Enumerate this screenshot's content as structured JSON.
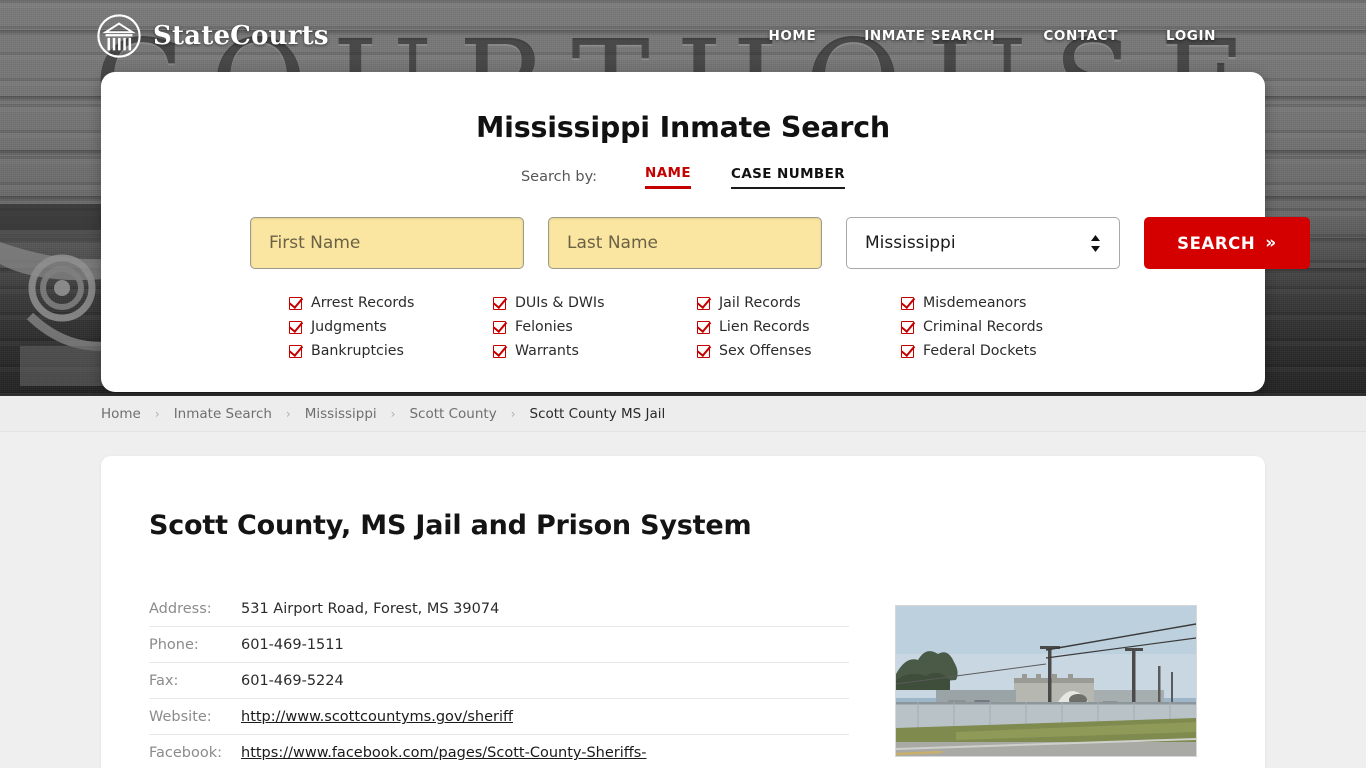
{
  "site": {
    "brand_name": "StateCourts",
    "logo_icon": "courthouse-circle-icon",
    "hero_background_word": "COURTHOUSE"
  },
  "nav": {
    "items": [
      {
        "label": "HOME",
        "name": "home"
      },
      {
        "label": "INMATE SEARCH",
        "name": "inmate-search"
      },
      {
        "label": "CONTACT",
        "name": "contact"
      },
      {
        "label": "LOGIN",
        "name": "login"
      }
    ]
  },
  "search_card": {
    "title": "Mississippi Inmate Search",
    "search_by_label": "Search by:",
    "tabs": [
      {
        "label": "NAME",
        "active": true
      },
      {
        "label": "CASE NUMBER",
        "active": false
      }
    ],
    "first_name_placeholder": "First Name",
    "first_name_value": "",
    "last_name_placeholder": "Last Name",
    "last_name_value": "",
    "state_selected": "Mississippi",
    "state_options": [
      "Mississippi"
    ],
    "search_button_label": "SEARCH",
    "search_button_chevron": "»",
    "accent_color": "#d40000",
    "input_fill_color": "#fae6a0",
    "record_types": [
      "Arrest Records",
      "DUIs & DWIs",
      "Jail Records",
      "Misdemeanors",
      "Judgments",
      "Felonies",
      "Lien Records",
      "Criminal Records",
      "Bankruptcies",
      "Warrants",
      "Sex Offenses",
      "Federal Dockets"
    ]
  },
  "breadcrumb": {
    "separator": "›",
    "items": [
      {
        "label": "Home",
        "current": false
      },
      {
        "label": "Inmate Search",
        "current": false
      },
      {
        "label": "Mississippi",
        "current": false
      },
      {
        "label": "Scott County",
        "current": false
      },
      {
        "label": "Scott County MS Jail",
        "current": true
      }
    ]
  },
  "main": {
    "page_title": "Scott County, MS Jail and Prison System",
    "details": [
      {
        "label": "Address:",
        "value": "531 Airport Road, Forest, MS 39074",
        "link": false
      },
      {
        "label": "Phone:",
        "value": "601-469-1511",
        "link": false
      },
      {
        "label": "Fax:",
        "value": "601-469-5224",
        "link": false
      },
      {
        "label": "Website:",
        "value": "http://www.scottcountyms.gov/sheriff",
        "link": true
      },
      {
        "label": "Facebook:",
        "value": "https://www.facebook.com/pages/Scott-County-Sheriffs-",
        "link": true
      }
    ],
    "photo_alt": "Scott County MS Jail facility street view"
  }
}
